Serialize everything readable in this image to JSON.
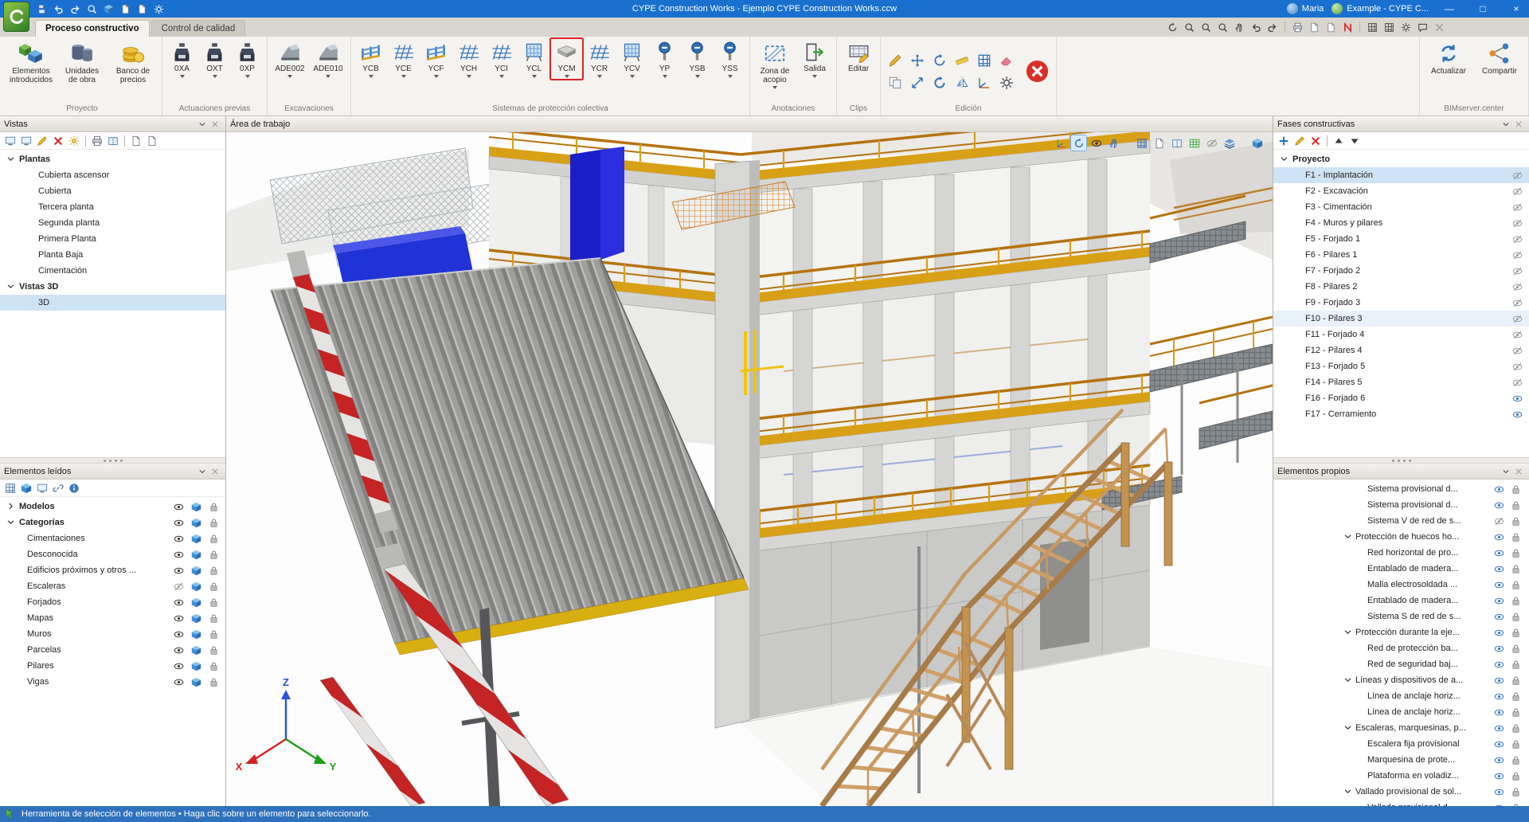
{
  "window": {
    "title": "CYPE Construction Works - Ejemplo CYPE Construction Works.ccw",
    "user_name": "Maria",
    "account_name": "Example - CYPE C...",
    "minimize_glyph": "—",
    "maximize_glyph": "□",
    "close_glyph": "×"
  },
  "titlebar_icons": [
    "app-logo",
    "save-icon",
    "undo-icon",
    "redo-icon",
    "zoom-icon",
    "block-3d-icon",
    "new-document-icon",
    "open-document-icon",
    "document-settings-icon"
  ],
  "tabs": {
    "proceso": "Proceso constructivo",
    "control": "Control de calidad"
  },
  "tabrow_icons": [
    "redraw-icon",
    "zoom-window-icon",
    "zoom-all-icon",
    "zoom-selection-icon",
    "pan-icon",
    "previous-view-icon",
    "next-view-icon",
    "print-icon",
    "new-window-icon",
    "duplicate-window-icon",
    "magnet-icon",
    "grid-icon",
    "snap-icon",
    "measure-settings-icon",
    "chat-icon",
    "cut-icon"
  ],
  "ribbon": {
    "proyecto": {
      "label": "Proyecto",
      "b1": "Elementos\nintroducidos",
      "b2": "Unidades\nde obra",
      "b3": "Banco de\nprecios"
    },
    "actuaciones_previas": {
      "label": "Actuaciones previas",
      "b1": "0XA",
      "b2": "OXT",
      "b3": "0XP"
    },
    "excavaciones": {
      "label": "Excavaciones",
      "b1": "ADE002",
      "b2": "ADE010"
    },
    "proteccion_colectiva": {
      "label": "Sistemas de protección colectiva",
      "b1": "YCB",
      "b2": "YCE",
      "b3": "YCF",
      "b4": "YCH",
      "b5": "YCI",
      "b6": "YCL",
      "b7": "YCM",
      "b8": "YCR",
      "b9": "YCV",
      "b10": "YP",
      "b11": "YSB",
      "b12": "YSS",
      "highlighted_item": "YCM"
    },
    "anotaciones": {
      "label": "Anotaciones",
      "b1": "Zona de\nacopio",
      "b2": "Salida"
    },
    "clips": {
      "label": "Clips",
      "b1": "Editar"
    },
    "edicion": {
      "label": "Edición",
      "icons": [
        "edit-icon",
        "copy-icon",
        "move-icon",
        "stretch-icon",
        "rotate-icon",
        "rotate-copy-icon",
        "measure-icon",
        "symmetry-icon",
        "matrix-icon",
        "axes-icon",
        "erase-icon",
        "tools-icon",
        "delete-red-x-button"
      ]
    },
    "bimserver": {
      "label": "BIMserver.center",
      "b1": "Actualizar",
      "b2": "Compartir"
    }
  },
  "vistas": {
    "title": "Vistas",
    "tool_icons": [
      "new-view-icon",
      "duplicate-view-icon",
      "edit-view-icon",
      "delete-view-icon",
      "sun-icon",
      "print-view-icon",
      "library-icon",
      "catalog-icon",
      "export-view-icon",
      "import-view-icon"
    ],
    "plantas": "Plantas",
    "p1": "Cubierta ascensor",
    "p2": "Cubierta",
    "p3": "Tercera planta",
    "p4": "Segunda planta",
    "p5": "Primera Planta",
    "p6": "Planta Baja",
    "p7": "Cimentación",
    "vistas3d": "Vistas 3D",
    "v1": "3D",
    "selected": "3D"
  },
  "elementos_leidos": {
    "title": "Elementos leídos",
    "tool_icons": [
      "models-icon",
      "model-3d-icon",
      "views-icon",
      "link-model-icon",
      "info-icon"
    ],
    "modelos": "Modelos",
    "categorias": "Categorías",
    "c1": "Cimentaciones",
    "c2": "Desconocida",
    "c3": "Edificios próximos y otros ...",
    "c4": "Escaleras",
    "c5": "Forjados",
    "c6": "Mapas",
    "c7": "Muros",
    "c8": "Parcelas",
    "c9": "Pilares",
    "c10": "Vigas"
  },
  "workspace": {
    "title": "Área de trabajo",
    "axis_x": "X",
    "axis_y": "Y",
    "axis_z": "Z",
    "tool_icons": [
      "coordinate-system-icon",
      "orbit-view-icon",
      "visibility-options-icon",
      "pan-view-icon",
      "section-view-icon",
      "tags-icon",
      "animation-icon",
      "green-table-icon",
      "visibility-edit-icon",
      "layers-icon",
      "workplane-icon"
    ]
  },
  "fases": {
    "title": "Fases constructivas",
    "tool_icons": [
      "add-phase-icon",
      "edit-phase-icon",
      "delete-phase-icon",
      "move-up-icon",
      "move-down-icon"
    ],
    "root": "Proyecto",
    "r1": "F1 - Implantación",
    "r2": "F2 - Excavación",
    "r3": "F3 - Cimentación",
    "r4": "F4 - Muros y pilares",
    "r5": "F5 - Forjado 1",
    "r6": "F6 - Pilares 1",
    "r7": "F7 - Forjado 2",
    "r8": "F8 - Pilares 2",
    "r9": "F9 - Forjado 3",
    "r10": "F10 - Pilares 3",
    "r11": "F11 - Forjado 4",
    "r12": "F12 - Pilares 4",
    "r13": "F13 - Forjado 5",
    "r14": "F14 - Pilares 5",
    "r15": "F16 - Forjado 6",
    "r16": "F17 - Cerramiento",
    "selected": "F1 - Implantación"
  },
  "elementos_propios": {
    "title": "Elementos propios",
    "e1": "Sistema provisional d...",
    "e2": "Sistema provisional d...",
    "e3": "Sistema V de red de s...",
    "e4": "Protección de huecos ho...",
    "e5": "Red horizontal de pro...",
    "e6": "Entablado de madera...",
    "e7": "Malla electrosoldada ...",
    "e8": "Entablado de madera...",
    "e9": "Sistema S de red de s...",
    "e10": "Protección durante la eje...",
    "e11": "Red de protección ba...",
    "e12": "Red de seguridad baj...",
    "e13": "Líneas y dispositivos de a...",
    "e14": "Línea de anclaje horiz...",
    "e15": "Línea de anclaje horiz...",
    "e16": "Escaleras, marquesinas, p...",
    "e17": "Escalera fija provisional",
    "e18": "Marquesina de prote...",
    "e19": "Plataforma en voladiz...",
    "e20": "Vallado provisional de sol...",
    "e21": "Vallado provisional d..."
  },
  "statusbar": {
    "text": "Herramienta de selección de elementos  •  Haga clic sobre un elemento para seleccionarlo."
  },
  "colors": {
    "titlebar": "#1a70cf",
    "statusbar": "#2e71bd",
    "selection": "#cfe3f6",
    "railing": "#b5730e",
    "toeboard": "#d8a016",
    "highlight_box": "#e02020",
    "app_green": "#3f9c35"
  }
}
